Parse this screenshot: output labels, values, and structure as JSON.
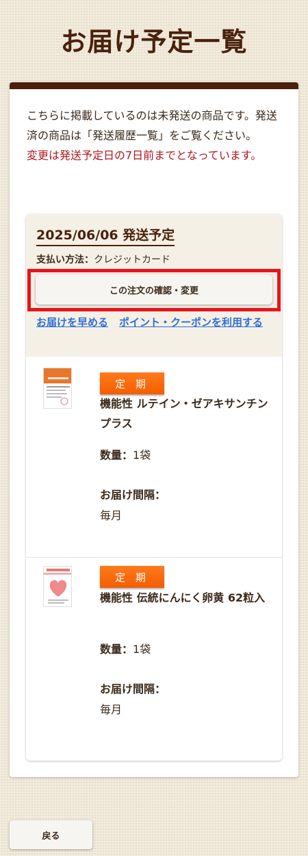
{
  "page": {
    "title": "お届け予定一覧"
  },
  "notice": {
    "text": "こちらに掲載しているのは未発送の商品です。発送済の商品は「発送履歴一覧」をご覧ください。",
    "warning": "変更は発送予定日の7日前までとなっています。"
  },
  "order": {
    "ship_date": "2025/06/06 発送予定",
    "payment_label": "支払い方法：",
    "payment_value": "クレジットカード",
    "confirm_button": "この注文の確認・変更",
    "link_earlier": "お届けを早める",
    "link_points": "ポイント・クーポンを利用する",
    "products": [
      {
        "badge": "定 期",
        "name": "機能性 ルテイン・ゼアキサンチンプラス",
        "qty_label": "数量：",
        "qty_value": "1袋",
        "interval_label": "お届け間隔：",
        "interval_value": "毎月"
      },
      {
        "badge": "定 期",
        "name": "機能性 伝統にんにく卵黄 62粒入",
        "qty_label": "数量：",
        "qty_value": "1袋",
        "interval_label": "お届け間隔：",
        "interval_value": "毎月"
      }
    ]
  },
  "footer": {
    "back_button": "戻る"
  },
  "colors": {
    "brand_brown": "#4a210c",
    "badge_orange": "#f56a0a",
    "link_blue": "#2f6ed8",
    "warning_red": "#b2161d",
    "highlight_red": "#e8141c"
  }
}
